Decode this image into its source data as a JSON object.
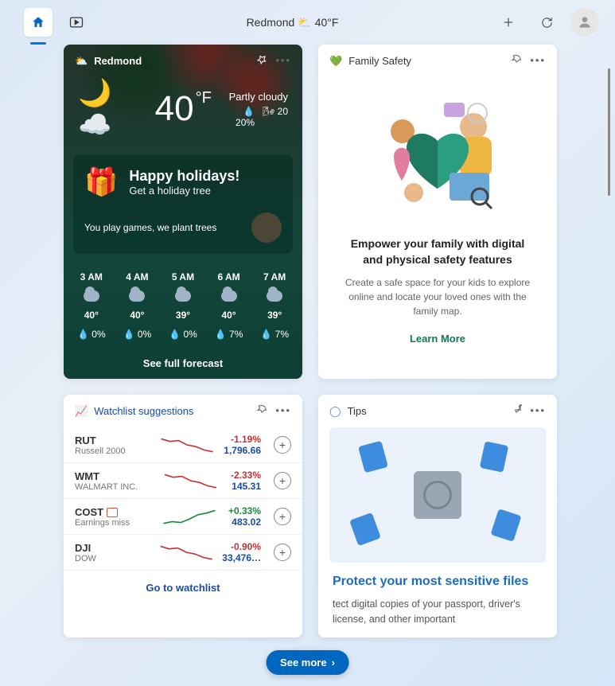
{
  "topbar": {
    "location": "Redmond",
    "temp": "40°F"
  },
  "weather": {
    "title": "Redmond",
    "temp": "40",
    "unit": "°F",
    "condition": "Partly cloudy",
    "precip": "20%",
    "wind": "20",
    "holiday_title": "Happy holidays!",
    "holiday_sub": "Get a holiday tree",
    "holiday_line": "You play games, we plant trees",
    "see_forecast": "See full forecast",
    "forecast": [
      {
        "time": "3 AM",
        "temp": "40°",
        "precip": "0%"
      },
      {
        "time": "4 AM",
        "temp": "40°",
        "precip": "0%"
      },
      {
        "time": "5 AM",
        "temp": "39°",
        "precip": "0%"
      },
      {
        "time": "6 AM",
        "temp": "40°",
        "precip": "7%"
      },
      {
        "time": "7 AM",
        "temp": "39°",
        "precip": "7%"
      }
    ]
  },
  "family": {
    "title": "Family Safety",
    "heading": "Empower your family with digital and physical safety features",
    "body": "Create a safe space for your kids to explore online and locate your loved ones with the family map.",
    "cta": "Learn More"
  },
  "watchlist": {
    "title": "Watchlist suggestions",
    "cta": "Go to watchlist",
    "items": [
      {
        "symbol": "RUT",
        "name": "Russell 2000",
        "change": "-1.19%",
        "price": "1,796.66",
        "dir": "neg",
        "note": ""
      },
      {
        "symbol": "WMT",
        "name": "WALMART INC.",
        "change": "-2.33%",
        "price": "145.31",
        "dir": "neg",
        "note": ""
      },
      {
        "symbol": "COST",
        "name": "Earnings miss",
        "change": "+0.33%",
        "price": "483.02",
        "dir": "pos",
        "note": "earnings"
      },
      {
        "symbol": "DJI",
        "name": "DOW",
        "change": "-0.90%",
        "price": "33,476…",
        "dir": "neg",
        "note": ""
      }
    ]
  },
  "tips": {
    "title": "Tips",
    "heading": "Protect your most sensitive files",
    "body": "tect digital copies of your passport, driver's license, and other important"
  },
  "see_more": "See more"
}
